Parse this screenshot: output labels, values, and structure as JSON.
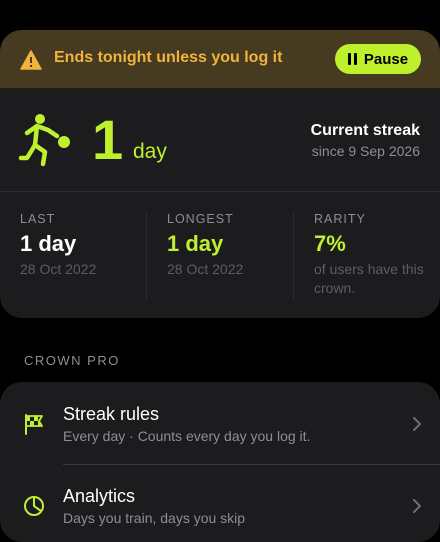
{
  "banner": {
    "message": "Ends tonight unless you log it",
    "pause_label": "Pause",
    "color": "#f0b43c"
  },
  "streak": {
    "count": "1",
    "unit": "day",
    "title": "Current streak",
    "since": "since 9 Sep 2026"
  },
  "stats": [
    {
      "label": "LAST",
      "value": "1 day",
      "sub": "28 Oct 2022"
    },
    {
      "label": "LONGEST",
      "value": "1 day",
      "sub": "28 Oct 2022"
    },
    {
      "label": "RARITY",
      "value": "7%",
      "sub": "of users have this crown."
    }
  ],
  "section": {
    "title": "CROWN PRO"
  },
  "pro_items": [
    {
      "title": "Streak rules",
      "subtitle": "Every day · Counts every day you log it.",
      "icon": "checkered-flag-icon"
    },
    {
      "title": "Analytics",
      "subtitle": "Days you train, days you skip",
      "icon": "pie-chart-icon"
    }
  ],
  "colors": {
    "accent": "#bff02d",
    "card": "#1c1c1e",
    "warning": "#f0b43c"
  }
}
